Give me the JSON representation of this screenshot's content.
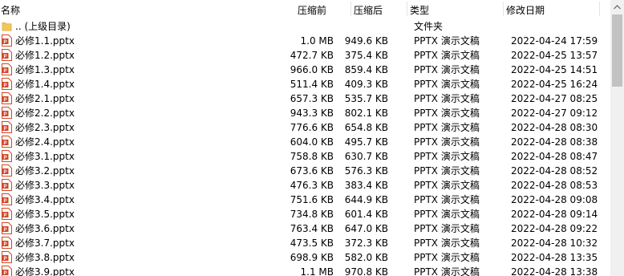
{
  "header": {
    "name": "名称",
    "size": "压缩前",
    "packed": "压缩后",
    "type": "类型",
    "modified": "修改日期"
  },
  "parent": {
    "name": ".. (上级目录)",
    "type": "文件夹"
  },
  "files": [
    {
      "name": "必修1.1.pptx",
      "size": "1.0 MB",
      "packed": "949.6 KB",
      "type": "PPTX 演示文稿",
      "modified": "2022-04-24 17:59"
    },
    {
      "name": "必修1.2.pptx",
      "size": "472.7 KB",
      "packed": "375.4 KB",
      "type": "PPTX 演示文稿",
      "modified": "2022-04-25 13:57"
    },
    {
      "name": "必修1.3.pptx",
      "size": "966.0 KB",
      "packed": "859.4 KB",
      "type": "PPTX 演示文稿",
      "modified": "2022-04-25 14:51"
    },
    {
      "name": "必修1.4.pptx",
      "size": "511.4 KB",
      "packed": "409.3 KB",
      "type": "PPTX 演示文稿",
      "modified": "2022-04-25 16:24"
    },
    {
      "name": "必修2.1.pptx",
      "size": "657.3 KB",
      "packed": "535.7 KB",
      "type": "PPTX 演示文稿",
      "modified": "2022-04-27 08:25"
    },
    {
      "name": "必修2.2.pptx",
      "size": "943.3 KB",
      "packed": "802.1 KB",
      "type": "PPTX 演示文稿",
      "modified": "2022-04-27 09:12"
    },
    {
      "name": "必修2.3.pptx",
      "size": "776.6 KB",
      "packed": "654.8 KB",
      "type": "PPTX 演示文稿",
      "modified": "2022-04-28 08:30"
    },
    {
      "name": "必修2.4.pptx",
      "size": "604.0 KB",
      "packed": "495.7 KB",
      "type": "PPTX 演示文稿",
      "modified": "2022-04-28 08:38"
    },
    {
      "name": "必修3.1.pptx",
      "size": "758.8 KB",
      "packed": "630.7 KB",
      "type": "PPTX 演示文稿",
      "modified": "2022-04-28 08:47"
    },
    {
      "name": "必修3.2.pptx",
      "size": "673.6 KB",
      "packed": "576.3 KB",
      "type": "PPTX 演示文稿",
      "modified": "2022-04-28 08:52"
    },
    {
      "name": "必修3.3.pptx",
      "size": "476.3 KB",
      "packed": "383.4 KB",
      "type": "PPTX 演示文稿",
      "modified": "2022-04-28 08:53"
    },
    {
      "name": "必修3.4.pptx",
      "size": "751.6 KB",
      "packed": "644.9 KB",
      "type": "PPTX 演示文稿",
      "modified": "2022-04-28 09:08"
    },
    {
      "name": "必修3.5.pptx",
      "size": "734.8 KB",
      "packed": "601.4 KB",
      "type": "PPTX 演示文稿",
      "modified": "2022-04-28 09:14"
    },
    {
      "name": "必修3.6.pptx",
      "size": "763.4 KB",
      "packed": "647.0 KB",
      "type": "PPTX 演示文稿",
      "modified": "2022-04-28 09:22"
    },
    {
      "name": "必修3.7.pptx",
      "size": "473.5 KB",
      "packed": "372.3 KB",
      "type": "PPTX 演示文稿",
      "modified": "2022-04-28 10:32"
    },
    {
      "name": "必修3.8.pptx",
      "size": "698.9 KB",
      "packed": "582.0 KB",
      "type": "PPTX 演示文稿",
      "modified": "2022-04-28 13:35"
    },
    {
      "name": "必修3.9.pptx",
      "size": "1.1 MB",
      "packed": "970.8 KB",
      "type": "PPTX 演示文稿",
      "modified": "2022-04-28 13:38"
    }
  ],
  "icons": {
    "folder": "folder-icon",
    "pptx": "pptx-file-icon",
    "scroll_up": "chevron-up-icon"
  },
  "colors": {
    "folder": "#f4c65a",
    "pptx": "#d24726"
  }
}
